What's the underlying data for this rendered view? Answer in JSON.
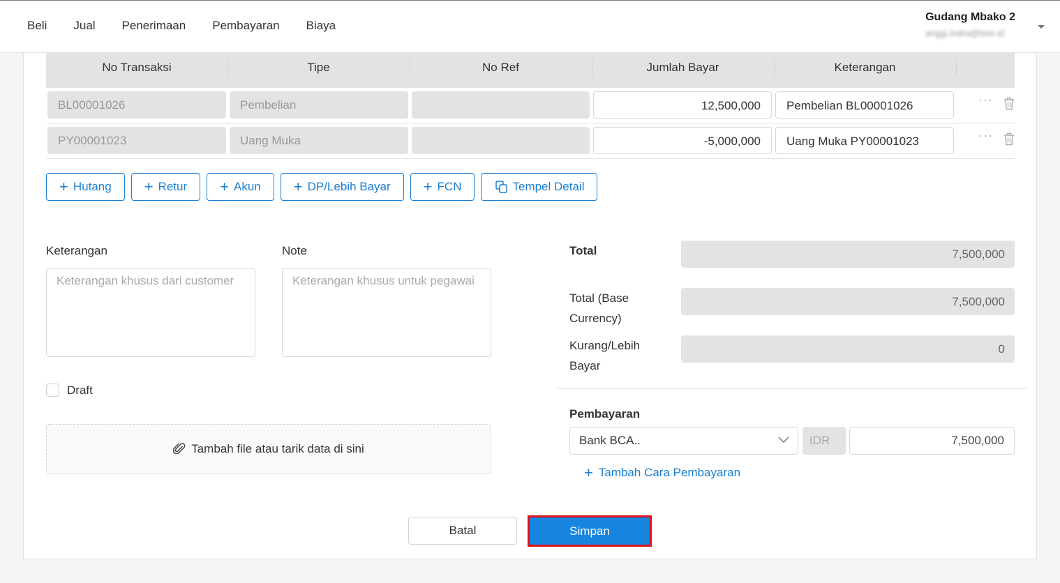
{
  "nav": {
    "items": [
      "Beli",
      "Jual",
      "Penerimaan",
      "Pembayaran",
      "Biaya"
    ]
  },
  "company": {
    "name": "Gudang Mbako 2",
    "email": "anggi.indra@bee.id"
  },
  "table": {
    "headers": [
      "No Transaksi",
      "Tipe",
      "No Ref",
      "Jumlah Bayar",
      "Keterangan"
    ],
    "rows": [
      {
        "no_transaksi": "BL00001026",
        "tipe": "Pembelian",
        "no_ref": "",
        "jumlah_bayar": "12,500,000",
        "keterangan": "Pembelian BL00001026"
      },
      {
        "no_transaksi": "PY00001023",
        "tipe": "Uang Muka",
        "no_ref": "",
        "jumlah_bayar": "-5,000,000",
        "keterangan": "Uang Muka PY00001023"
      }
    ]
  },
  "actions": {
    "hutang": "Hutang",
    "retur": "Retur",
    "akun": "Akun",
    "dp": "DP/Lebih Bayar",
    "fcn": "FCN",
    "tempel": "Tempel Detail"
  },
  "notes": {
    "keterangan_label": "Keterangan",
    "keterangan_placeholder": "Keterangan khusus dari customer",
    "note_label": "Note",
    "note_placeholder": "Keterangan khusus untuk pegawai"
  },
  "draft": {
    "label": "Draft",
    "checked": false
  },
  "attachment": {
    "label": "Tambah file atau tarik data di sini"
  },
  "summary": {
    "total_label": "Total",
    "total_value": "7,500,000",
    "base_label_1": "Total (Base",
    "base_label_2": "Currency)",
    "base_value": "7,500,000",
    "kurang_label_1": "Kurang/Lebih",
    "kurang_label_2": "Bayar",
    "kurang_value": "0"
  },
  "payment": {
    "label": "Pembayaran",
    "method": "Bank BCA..",
    "currency": "IDR",
    "amount": "7,500,000",
    "add_label": "Tambah Cara Pembayaran"
  },
  "footer": {
    "cancel": "Batal",
    "save": "Simpan"
  },
  "colors": {
    "accent": "#1a7fd1",
    "primary_button": "#1784df",
    "highlight_border": "#e0111b",
    "readonly_bg": "#e3e3e3"
  }
}
